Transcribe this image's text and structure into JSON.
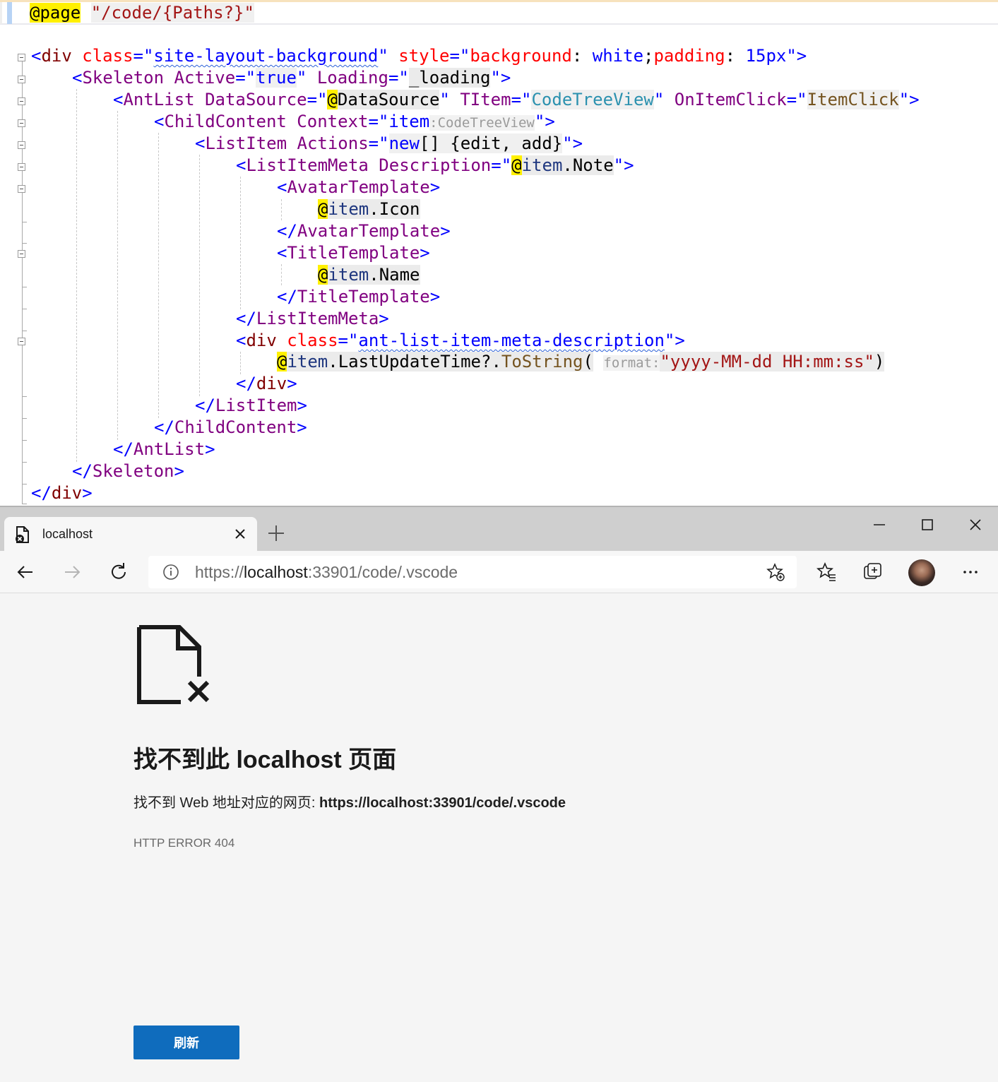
{
  "editor": {
    "page_directive": {
      "at": "@",
      "keyword": "page",
      "route": "\"/code/{Paths?}\""
    },
    "l1": {
      "open": "<",
      "tag": "div",
      "a1": "class",
      "eq1": "=\"",
      "v1": "site-layout-background",
      "q1": "\"",
      "a2": "style",
      "eq2": "=\"",
      "css_prop1": "background",
      "colon1": ": ",
      "css_val1": "white",
      "semi": ";",
      "css_prop2": "padding",
      "colon2": ": ",
      "css_val2": "15px",
      "close": "\">"
    },
    "l2": {
      "open": "<",
      "tag": "Skeleton",
      "a1": "Active",
      "eq1": "=\"",
      "v1": "true",
      "q1": "\"",
      "a2": "Loading",
      "eq2": "=\"",
      "v2": "_loading",
      "close": "\">"
    },
    "l3": {
      "open": "<",
      "tag": "AntList",
      "a1": "DataSource",
      "eq1": "=\"",
      "at": "@",
      "v1": "DataSource",
      "q1": "\"",
      "a2": "TItem",
      "eq2": "=\"",
      "v2": "CodeTreeView",
      "q2": "\"",
      "a3": "OnItemClick",
      "eq3": "=\"",
      "v3": "ItemClick",
      "close": "\">"
    },
    "l4": {
      "open": "<",
      "tag": "ChildContent",
      "a1": "Context",
      "eq1": "=\"",
      "v1": "item",
      "hint": ":CodeTreeView",
      "close": "\">"
    },
    "l5": {
      "open": "<",
      "tag": "ListItem",
      "a1": "Actions",
      "eq1": "=\"",
      "kw": "new",
      "rest": "[] {edit, add}",
      "close": "\">"
    },
    "l6": {
      "open": "<",
      "tag": "ListItemMeta",
      "a1": "Description",
      "eq1": "=\"",
      "at": "@",
      "id": "item",
      "rest": ".Note",
      "close": "\">"
    },
    "l7": {
      "open": "<",
      "tag": "AvatarTemplate",
      "close": ">"
    },
    "l8": {
      "at": "@",
      "id": "item",
      "rest": ".Icon"
    },
    "l9": {
      "open": "</",
      "tag": "AvatarTemplate",
      "close": ">"
    },
    "l10": {
      "open": "<",
      "tag": "TitleTemplate",
      "close": ">"
    },
    "l11": {
      "at": "@",
      "id": "item",
      "rest": ".Name"
    },
    "l12": {
      "open": "</",
      "tag": "TitleTemplate",
      "close": ">"
    },
    "l13": {
      "open": "</",
      "tag": "ListItemMeta",
      "close": ">"
    },
    "l14": {
      "open": "<",
      "tag": "div",
      "a1": "class",
      "eq1": "=\"",
      "v1": "ant-list-item-meta-description",
      "close": "\">"
    },
    "l15": {
      "at": "@",
      "id": "item",
      "rest": ".LastUpdateTime?.",
      "meth": "ToString",
      "paren": "(",
      "hint": "format:",
      "str": "\"yyyy-MM-dd HH:mm:ss\"",
      "cparen": ")"
    },
    "l16": {
      "open": "</",
      "tag": "div",
      "close": ">"
    },
    "l17": {
      "open": "</",
      "tag": "ListItem",
      "close": ">"
    },
    "l18": {
      "open": "</",
      "tag": "ChildContent",
      "close": ">"
    },
    "l19": {
      "open": "</",
      "tag": "AntList",
      "close": ">"
    },
    "l20": {
      "open": "</",
      "tag": "Skeleton",
      "close": ">"
    },
    "l21": {
      "open": "</",
      "tag": "div",
      "close": ">"
    }
  },
  "browser": {
    "tab": {
      "title": "localhost",
      "favicon": "broken-page-icon",
      "close_icon": "close-icon"
    },
    "new_tab_icon": "plus-icon",
    "window_controls": [
      "minimize-icon",
      "maximize-icon",
      "close-icon"
    ],
    "toolbar_icons": [
      "back-arrow-icon",
      "forward-arrow-icon",
      "refresh-icon",
      "favorites-icon",
      "collections-icon",
      "more-icon"
    ],
    "address": {
      "scheme": "https://",
      "host": "localhost",
      "rest": ":33901/code/.vscode",
      "info_icon": "info-icon",
      "star_icon": "add-favorite-icon"
    },
    "error": {
      "icon": "page-not-found-icon",
      "title": "找不到此 localhost 页面",
      "desc_prefix": "找不到 Web 地址对应的网页: ",
      "desc_url": "https://localhost:33901/code/.vscode",
      "code": "HTTP ERROR 404",
      "button": "刷新"
    },
    "colors": {
      "accent": "#0f6cbd",
      "tabstrip": "#cfcfcf",
      "page_bg": "#f5f5f5"
    }
  }
}
